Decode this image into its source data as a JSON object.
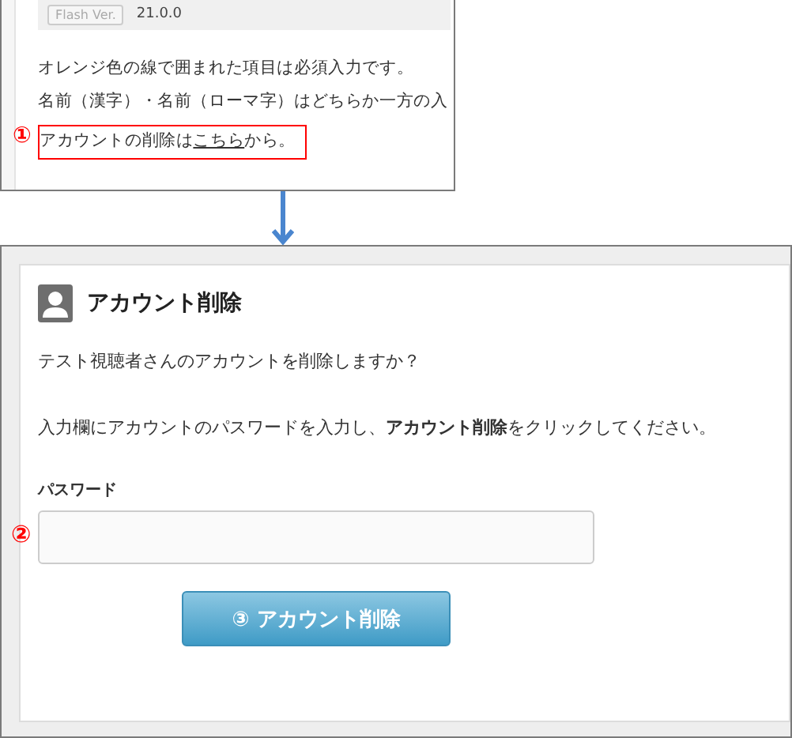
{
  "top_panel": {
    "version_badge": "Flash Ver.",
    "version": "21.0.0",
    "lines": [
      "オレンジ色の線で囲まれた項目は必須入力です。",
      "名前（漢字）・名前（ローマ字）はどちらか一方の入"
    ],
    "delete_line": {
      "marker": "①",
      "before": "アカウントの削除は",
      "link": "こちら",
      "after": "から。"
    }
  },
  "dialog": {
    "title": "アカウント削除",
    "question": "テスト視聴者さんのアカウントを削除しますか？",
    "instruction": "入力欄にアカウントのパスワードを入力し、**アカウント削除**をクリックしてください。",
    "password": {
      "label": "パスワード",
      "marker": "②"
    },
    "button": "③ アカウント削除"
  }
}
